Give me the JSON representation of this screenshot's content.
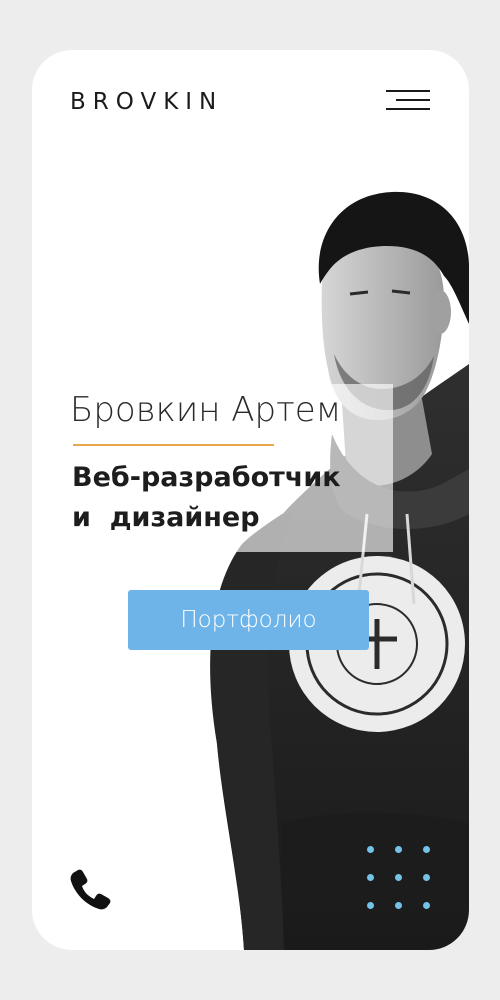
{
  "header": {
    "logo_text": "BROVKIN",
    "menu_icon": "hamburger-menu-icon"
  },
  "hero": {
    "name": "Бровкин Артем",
    "role_line1": "Веб-разработчик",
    "role_line2": "и  дизайнер",
    "portfolio_button": "Портфолио",
    "photo": "black-and-white-portrait-photo"
  },
  "footer": {
    "phone_icon": "phone-icon",
    "dots_icon": "dot-grid-decoration"
  },
  "colors": {
    "background": "#ededee",
    "card": "#ffffff",
    "accent_underline": "#e8a74c",
    "button": "#6eb4e8",
    "dots": "#74c3e6",
    "text": "#1b1b1b"
  }
}
